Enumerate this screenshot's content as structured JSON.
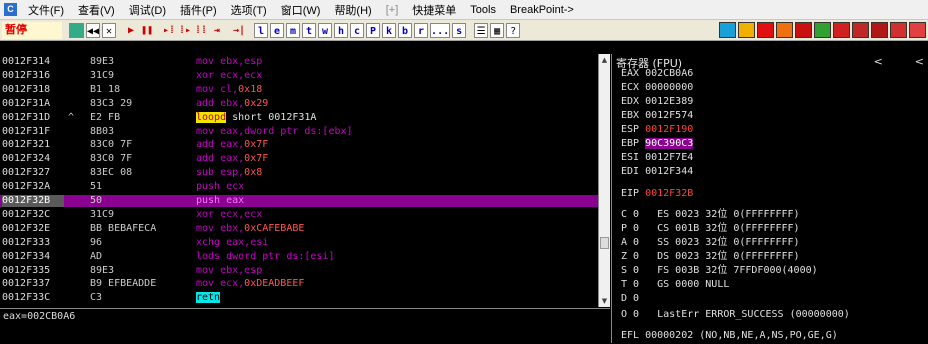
{
  "menubar": {
    "app_icon": "C",
    "items": [
      "文件(F)",
      "查看(V)",
      "调试(D)",
      "插件(P)",
      "选项(T)",
      "窗口(W)",
      "帮助(H)",
      "[+]",
      "快捷菜单",
      "Tools",
      "BreakPoint->"
    ]
  },
  "toolbar": {
    "state": "暂停",
    "buttons": [
      "◀◀",
      "✕",
      "▶",
      "❚❚",
      "▸⁞",
      "⁞▸",
      "⁞⁞",
      "⇥",
      "→|"
    ],
    "letter_buttons": [
      "l",
      "e",
      "m",
      "t",
      "w",
      "h",
      "c",
      "P",
      "k",
      "b",
      "r",
      "...",
      "s"
    ],
    "right_buttons": [
      "☰",
      "▦",
      "?"
    ]
  },
  "disasm": {
    "rows": [
      {
        "addr": "0012F314",
        "arrow": "",
        "hex": "89E3",
        "tokens": [
          [
            "mov",
            "cm"
          ],
          [
            " ebx,esp",
            "cm"
          ]
        ]
      },
      {
        "addr": "0012F316",
        "arrow": "",
        "hex": "31C9",
        "tokens": [
          [
            "xor",
            "cm"
          ],
          [
            " ecx,ecx",
            "cm"
          ]
        ]
      },
      {
        "addr": "0012F318",
        "arrow": "",
        "hex": "B1 18",
        "tokens": [
          [
            "mov",
            "cm"
          ],
          [
            " cl,",
            "cm"
          ],
          [
            "0x18",
            "cr"
          ]
        ]
      },
      {
        "addr": "0012F31A",
        "arrow": "",
        "hex": "83C3 29",
        "tokens": [
          [
            "add",
            "cm"
          ],
          [
            " ebx,",
            "cm"
          ],
          [
            "0x29",
            "cr"
          ]
        ]
      },
      {
        "addr": "0012F31D",
        "arrow": "^",
        "hex": "E2 FB",
        "tokens": [
          [
            "loopd",
            "hly"
          ],
          [
            " short 0012F31A",
            "cw"
          ]
        ]
      },
      {
        "addr": "0012F31F",
        "arrow": "",
        "hex": "8B03",
        "tokens": [
          [
            "mov",
            "cm"
          ],
          [
            " eax,dword ptr ds:[ebx]",
            "cm"
          ]
        ]
      },
      {
        "addr": "0012F321",
        "arrow": "",
        "hex": "83C0 7F",
        "tokens": [
          [
            "add",
            "cm"
          ],
          [
            " eax,",
            "cm"
          ],
          [
            "0x7F",
            "cr"
          ]
        ]
      },
      {
        "addr": "0012F324",
        "arrow": "",
        "hex": "83C0 7F",
        "tokens": [
          [
            "add",
            "cm"
          ],
          [
            " eax,",
            "cm"
          ],
          [
            "0x7F",
            "cr"
          ]
        ]
      },
      {
        "addr": "0012F327",
        "arrow": "",
        "hex": "83EC 08",
        "tokens": [
          [
            "sub",
            "cm"
          ],
          [
            " esp,",
            "cm"
          ],
          [
            "0x8",
            "cr"
          ]
        ]
      },
      {
        "addr": "0012F32A",
        "arrow": "",
        "hex": "51",
        "tokens": [
          [
            "push",
            "cm"
          ],
          [
            " ecx",
            "cm"
          ]
        ]
      },
      {
        "addr": "0012F32B",
        "arrow": "",
        "hex": "50",
        "tokens": [
          [
            "push",
            "cm"
          ],
          [
            " eax",
            "cm"
          ]
        ],
        "selected": true
      },
      {
        "addr": "0012F32C",
        "arrow": "",
        "hex": "31C9",
        "tokens": [
          [
            "xor",
            "cm"
          ],
          [
            " ecx,ecx",
            "cm"
          ]
        ]
      },
      {
        "addr": "0012F32E",
        "arrow": "",
        "hex": "BB BEBAFECA",
        "tokens": [
          [
            "mov",
            "cm"
          ],
          [
            " ebx,",
            "cm"
          ],
          [
            "0xCAFEBABE",
            "cr"
          ]
        ]
      },
      {
        "addr": "0012F333",
        "arrow": "",
        "hex": "96",
        "tokens": [
          [
            "xchg",
            "cm"
          ],
          [
            " eax,esi",
            "cm"
          ]
        ]
      },
      {
        "addr": "0012F334",
        "arrow": "",
        "hex": "AD",
        "tokens": [
          [
            "lods",
            "cm"
          ],
          [
            " dword ptr ds:[esi]",
            "cm"
          ]
        ]
      },
      {
        "addr": "0012F335",
        "arrow": "",
        "hex": "89E3",
        "tokens": [
          [
            "mov",
            "cm"
          ],
          [
            " ebx,esp",
            "cm"
          ]
        ]
      },
      {
        "addr": "0012F337",
        "arrow": "",
        "hex": "B9 EFBEADDE",
        "tokens": [
          [
            "mov",
            "cm"
          ],
          [
            " ecx,",
            "cm"
          ],
          [
            "0xDEADBEEF",
            "cr"
          ]
        ]
      },
      {
        "addr": "0012F33C",
        "arrow": "",
        "hex": "C3",
        "tokens": [
          [
            "retn",
            "hlc"
          ]
        ]
      }
    ]
  },
  "info": {
    "text": "eax=002CB0A6"
  },
  "registers": {
    "header": "寄存器 (FPU)",
    "nav_left": "<",
    "nav_right": "<",
    "lines": [
      {
        "text": "EAX 002CB0A6",
        "cls": "rv"
      },
      {
        "text": "ECX 00000000",
        "cls": "rv"
      },
      {
        "text": "EDX 0012E389",
        "cls": "rv"
      },
      {
        "text": "EBX 0012F574",
        "cls": "rv"
      },
      {
        "name": "ESP",
        "value": "0012F190",
        "cls": "rr"
      },
      {
        "name": "EBP",
        "value": "90C390C3",
        "cls": "rsel"
      },
      {
        "text": "ESI 0012F7E4",
        "cls": "rv"
      },
      {
        "text": "EDI 0012F344",
        "cls": "rv"
      },
      {
        "name": "EIP",
        "value": "0012F32B",
        "cls": "rr"
      },
      {
        "text": "C 0   ES 0023 32位 0(FFFFFFFF)",
        "cls": "rv"
      },
      {
        "text": "P 0   CS 001B 32位 0(FFFFFFFF)",
        "cls": "rv"
      },
      {
        "text": "A 0   SS 0023 32位 0(FFFFFFFF)",
        "cls": "rv"
      },
      {
        "text": "Z 0   DS 0023 32位 0(FFFFFFFF)",
        "cls": "rv"
      },
      {
        "text": "S 0   FS 003B 32位 7FFDF000(4000)",
        "cls": "rv"
      },
      {
        "text": "T 0   GS 0000 NULL",
        "cls": "rv"
      },
      {
        "text": "D 0",
        "cls": "rv"
      },
      {
        "text": "O 0   LastErr ERROR_SUCCESS (00000000)",
        "cls": "rv"
      },
      {
        "text": "EFL 00000202 (NO,NB,NE,A,NS,PO,GE,G)",
        "cls": "rv"
      }
    ]
  },
  "colors": {
    "selection": "#8a0090",
    "mnemonic": "#c800c8",
    "immediate": "#ff5555",
    "jump_highlight": "#f2e600",
    "ret_highlight": "#00e8e8"
  }
}
